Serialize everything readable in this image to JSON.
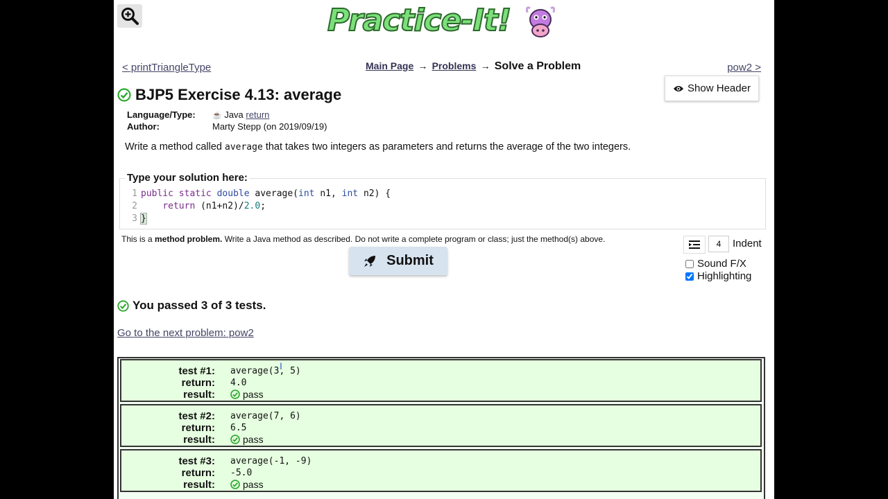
{
  "logo": {
    "text": "Practice-It!"
  },
  "nav": {
    "prev": "< printTriangleType",
    "next": "pow2 >",
    "crumbs": {
      "main": "Main Page",
      "arrow1": "→",
      "problems": "Problems",
      "arrow2": "→",
      "current": "Solve a Problem"
    }
  },
  "show_header": "Show Header",
  "problem": {
    "title": "BJP5 Exercise 4.13: average",
    "lang_label": "Language/Type:",
    "lang_value": "Java",
    "lang_type": "return",
    "author_label": "Author:",
    "author_value": "Marty Stepp (on 2019/09/19)",
    "desc_before": "Write a method called ",
    "desc_code": "average",
    "desc_after": " that takes two integers as parameters and returns the average of the two integers."
  },
  "solution": {
    "label": "Type your solution here:",
    "lines": [
      {
        "n": "1",
        "tokens": [
          [
            "kw",
            "public"
          ],
          [
            "",
            " "
          ],
          [
            "kw",
            "static"
          ],
          [
            "",
            " "
          ],
          [
            "ty",
            "double"
          ],
          [
            "",
            " average("
          ],
          [
            "ty",
            "int"
          ],
          [
            "",
            " n1, "
          ],
          [
            "ty",
            "int"
          ],
          [
            "",
            " n2) {"
          ]
        ]
      },
      {
        "n": "2",
        "tokens": [
          [
            "",
            "    "
          ],
          [
            "kw",
            "return"
          ],
          [
            "",
            " (n1+n2)/"
          ],
          [
            "num",
            "2.0"
          ],
          [
            "",
            ";"
          ]
        ]
      },
      {
        "n": "3",
        "tokens": [
          [
            "brace",
            "}"
          ]
        ]
      }
    ]
  },
  "note": {
    "before": "This is a ",
    "bold": "method problem.",
    "after": " Write a Java method as described. Do not write a complete program or class; just the method(s) above."
  },
  "submit": "Submit",
  "settings": {
    "indent_value": "4",
    "indent_label": "Indent",
    "sound_label": "Sound F/X",
    "sound_checked": false,
    "highlight_label": "Highlighting",
    "highlight_checked": true
  },
  "results": {
    "summary": "You passed 3 of 3 tests.",
    "next_link": "Go to the next problem: pow2",
    "labels": {
      "test": "test",
      "return": "return:",
      "result": "result:"
    },
    "tests": [
      {
        "label": "test #1:",
        "call": "average(3, 5)",
        "ret": "4.0",
        "result": "pass"
      },
      {
        "label": "test #2:",
        "call": "average(7, 6)",
        "ret": "6.5",
        "result": "pass"
      },
      {
        "label": "test #3:",
        "call": "average(-1, -9)",
        "ret": "-5.0",
        "result": "pass"
      }
    ]
  },
  "colors": {
    "pass_green": "#2ea82e",
    "test_bg": "#e6ffe0",
    "submit_bg": "#d7e3ee"
  }
}
